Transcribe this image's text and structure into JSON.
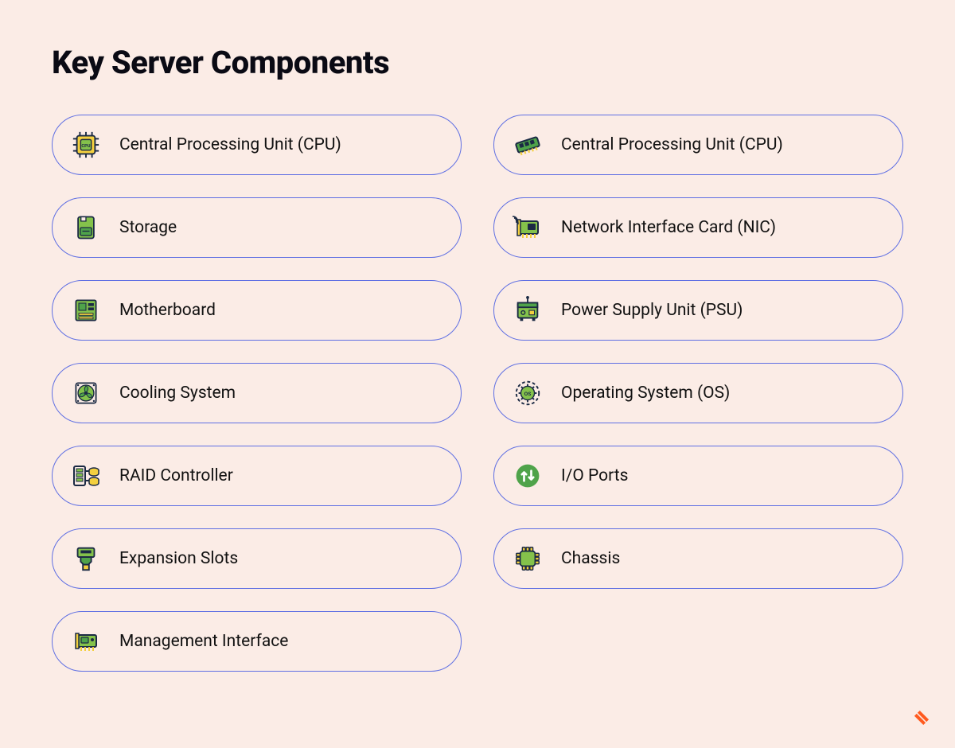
{
  "title": "Key Server Components",
  "colors": {
    "background": "#fbece6",
    "pill_border": "#5f6fe3",
    "icon_green": "#84c24b",
    "icon_green_dark": "#4fa34a",
    "icon_outline": "#1b2a44",
    "brand_orange": "#ff5a1f"
  },
  "items": [
    {
      "icon": "cpu",
      "label": "Central Processing Unit (CPU)"
    },
    {
      "icon": "ram",
      "label": "Central Processing Unit (CPU)"
    },
    {
      "icon": "storage",
      "label": "Storage"
    },
    {
      "icon": "nic",
      "label": "Network Interface Card (NIC)"
    },
    {
      "icon": "motherboard",
      "label": "Motherboard"
    },
    {
      "icon": "psu",
      "label": "Power Supply Unit (PSU)"
    },
    {
      "icon": "cooling",
      "label": "Cooling System"
    },
    {
      "icon": "os",
      "label": "Operating System (OS)"
    },
    {
      "icon": "raid",
      "label": "RAID Controller"
    },
    {
      "icon": "io",
      "label": "I/O Ports"
    },
    {
      "icon": "expansion",
      "label": "Expansion Slots"
    },
    {
      "icon": "chassis",
      "label": "Chassis"
    },
    {
      "icon": "mgmt",
      "label": "Management Interface"
    }
  ],
  "brand_icon": "geekflare"
}
